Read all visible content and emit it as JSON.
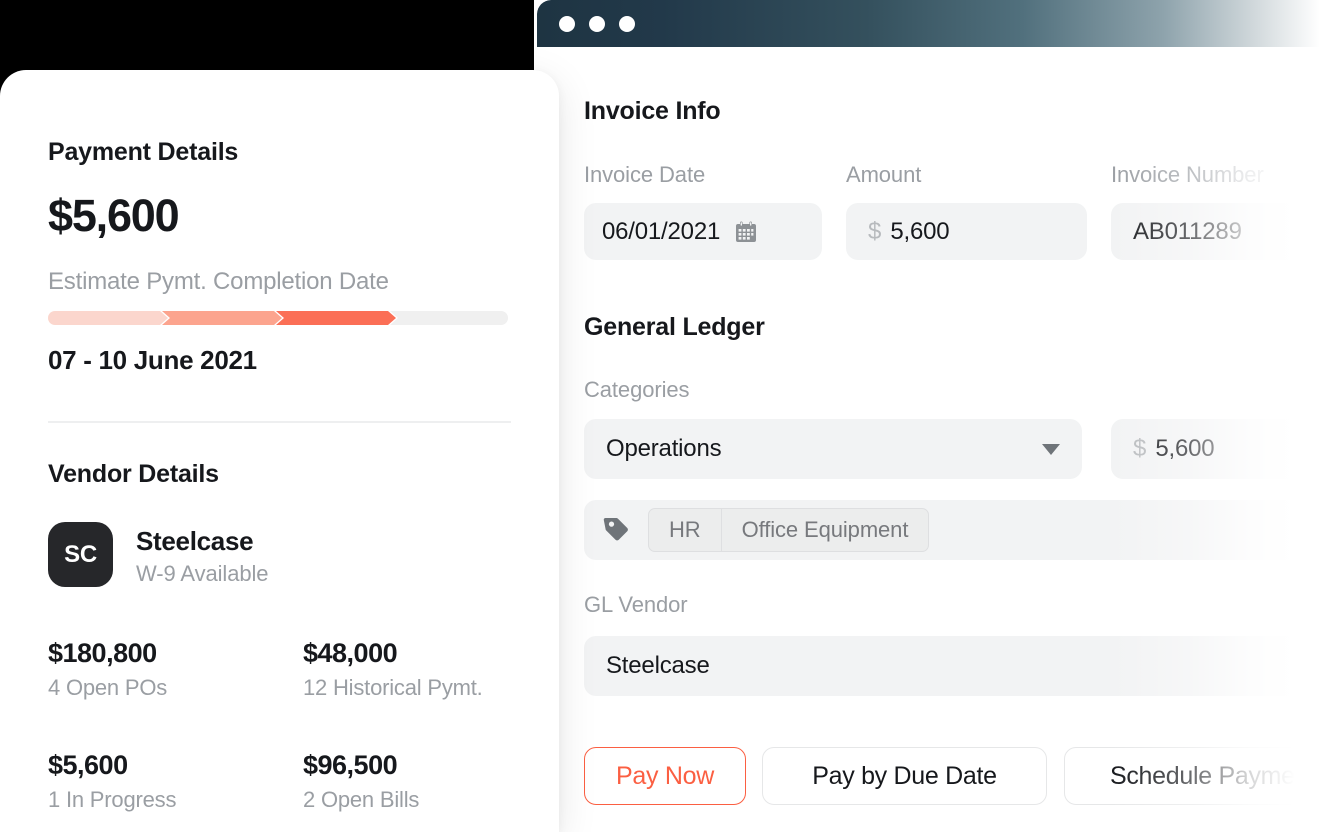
{
  "window": {
    "traffic_lights": [
      "close",
      "minimize",
      "maximize"
    ]
  },
  "right_panel": {
    "invoice_info": {
      "heading": "Invoice Info",
      "fields": [
        {
          "label": "Invoice Date",
          "value": "06/01/2021",
          "prefix": "",
          "icon": "calendar-icon"
        },
        {
          "label": "Amount",
          "value": "5,600",
          "prefix": "$",
          "icon": ""
        },
        {
          "label": "Invoice Number",
          "value": "AB011289",
          "prefix": "",
          "icon": ""
        }
      ]
    },
    "general_ledger": {
      "heading": "General Ledger",
      "categories_label": "Categories",
      "category_value": "Operations",
      "category_amount_prefix": "$",
      "category_amount": "5,600",
      "tags": [
        "HR",
        "Office Equipment"
      ],
      "gl_vendor_label": "GL Vendor",
      "gl_vendor_value": "Steelcase"
    },
    "actions": [
      {
        "label": "Pay Now",
        "style": "primary"
      },
      {
        "label": "Pay by Due Date",
        "style": "default"
      },
      {
        "label": "Schedule Payment",
        "style": "default"
      }
    ]
  },
  "left_card": {
    "payment_details": {
      "heading": "Payment Details",
      "amount": "$5,600",
      "estimate_label": "Estimate Pymt. Completion Date",
      "estimate_date": "07 - 10 June 2021",
      "progress": {
        "segments": [
          {
            "color": "#fbd6cd",
            "width": 120
          },
          {
            "color": "#fca48e",
            "width": 120
          },
          {
            "color": "#fb6f56",
            "width": 120
          },
          {
            "color": "#f0f0f0",
            "width": 118
          }
        ]
      }
    },
    "vendor_details": {
      "heading": "Vendor Details",
      "avatar_initials": "SC",
      "name": "Steelcase",
      "subtitle": "W-9 Available",
      "stats": [
        {
          "value": "$180,800",
          "label": "4 Open POs"
        },
        {
          "value": "$48,000",
          "label": "12 Historical Pymt."
        },
        {
          "value": "$5,600",
          "label": "1 In Progress"
        },
        {
          "value": "$96,500",
          "label": "2 Open Bills"
        }
      ]
    }
  },
  "colors": {
    "accent": "#fb5f42",
    "dark": "#16181c",
    "muted": "#9a9ea3",
    "field_bg": "#f2f3f4"
  }
}
